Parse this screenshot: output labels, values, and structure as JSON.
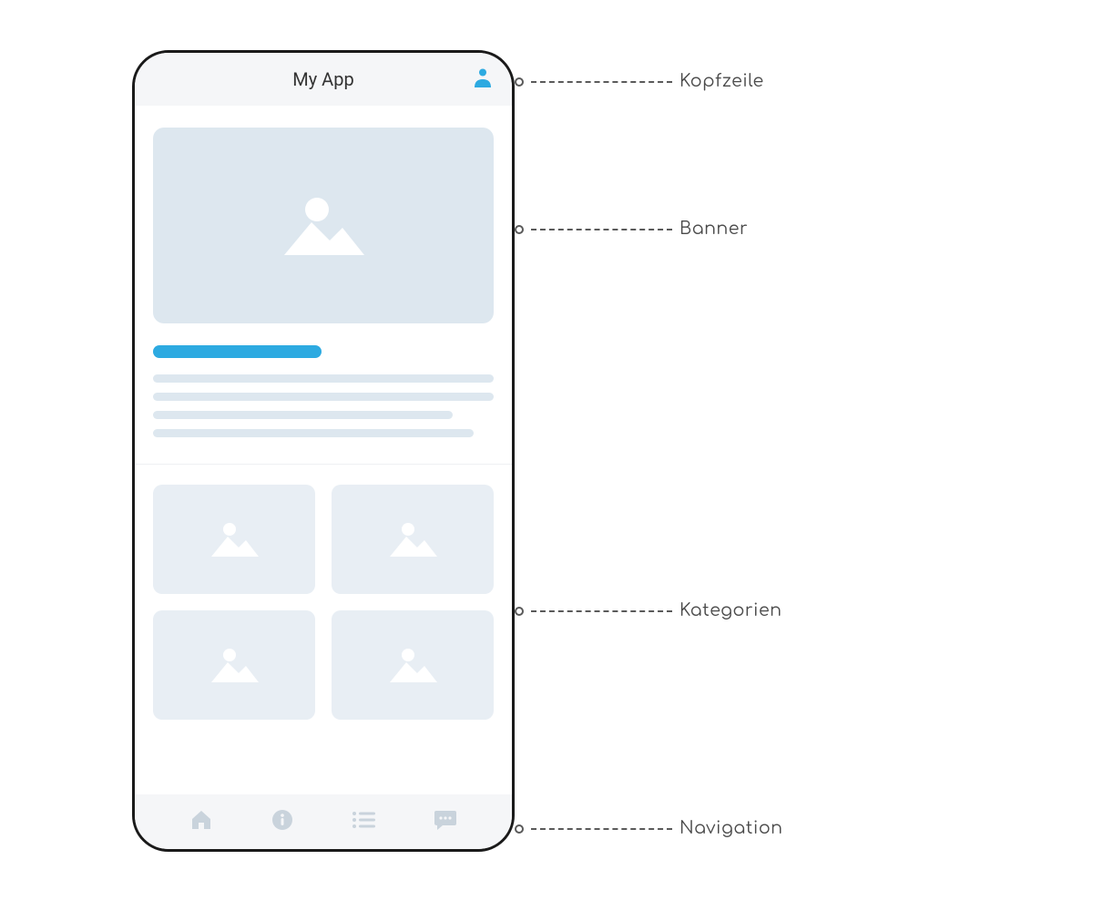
{
  "header": {
    "title": "My App"
  },
  "annotations": {
    "header": "Kopfzeile",
    "banner": "Banner",
    "categories": "Kategorien",
    "navigation": "Navigation"
  },
  "colors": {
    "accent": "#2daae1",
    "placeholder": "#dde7ef",
    "nav_icon": "#c9d3dc"
  },
  "nav_items": [
    "home",
    "info",
    "list",
    "chat"
  ]
}
